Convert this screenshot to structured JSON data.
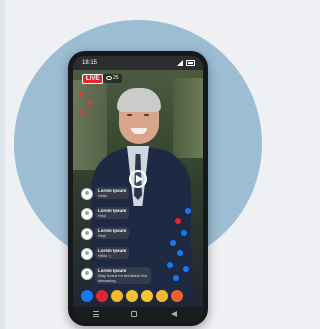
{
  "status_bar": {
    "time": "18:15"
  },
  "stream": {
    "live_label": "LIVE",
    "viewer_count": "25"
  },
  "comments": [
    {
      "name": "Lorem Ipsum",
      "message": "Hello"
    },
    {
      "name": "Lorem Ipsum",
      "message": "Hey!"
    },
    {
      "name": "Lorem Ipsum",
      "message": "Hey!"
    },
    {
      "name": "Lorem Ipsum",
      "message": "Hello :)"
    },
    {
      "name": "Lorem Ipsum",
      "message": "Stay tuned for feedback live streaming"
    }
  ],
  "colors": {
    "background_circle": "#9cbdd2",
    "live_red": "#e0262f",
    "like_blue": "#1877f2"
  },
  "reactions": [
    "like-icon",
    "love-icon",
    "care-icon",
    "haha-icon",
    "wow-icon",
    "sad-icon",
    "angry-icon"
  ]
}
